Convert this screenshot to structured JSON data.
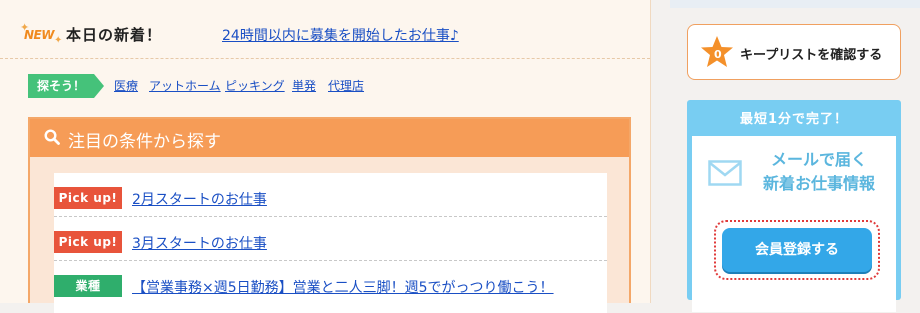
{
  "news": {
    "logo": "NEW",
    "title": "本日の新着！",
    "link": "24時間以内に募集を開始したお仕事♪"
  },
  "search": {
    "tag": "探そう！",
    "keywords": [
      "医療",
      "アットホーム",
      "ピッキング",
      "単発",
      "代理店"
    ]
  },
  "featured": {
    "title": "注目の条件から探す",
    "items": [
      {
        "badge": "Pick up!",
        "badge_type": "pick",
        "text": "2月スタートのお仕事"
      },
      {
        "badge": "Pick up!",
        "badge_type": "pick",
        "text": "3月スタートのお仕事"
      },
      {
        "badge": "業種",
        "badge_type": "type",
        "text": "【営業事務×週5日勤務】営業と二人三脚！週5でがっつり働こう！"
      }
    ]
  },
  "sidebar": {
    "keep_count": "0",
    "keep_label": "キープリストを確認する",
    "mail_header": "最短1分で完了！",
    "mail_line1": "メールで届く",
    "mail_line2": "新着お仕事情報",
    "register_label": "会員登録する"
  },
  "colors": {
    "accent_orange": "#f69c57",
    "link_blue": "#1a4fc4",
    "pick_red": "#e8543b",
    "green": "#45c27a",
    "sky_blue": "#78cdf2",
    "button_blue": "#33a7e8"
  }
}
